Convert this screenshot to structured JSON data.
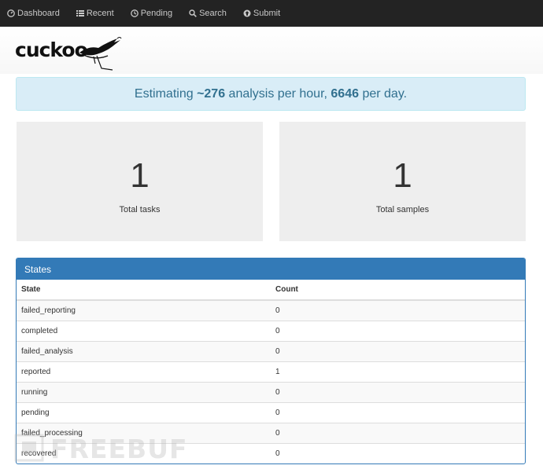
{
  "nav": {
    "items": [
      {
        "label": "Dashboard",
        "icon": "dashboard-icon"
      },
      {
        "label": "Recent",
        "icon": "list-icon"
      },
      {
        "label": "Pending",
        "icon": "clock-icon"
      },
      {
        "label": "Search",
        "icon": "search-icon"
      },
      {
        "label": "Submit",
        "icon": "upload-icon"
      }
    ]
  },
  "logo": {
    "text": "cuckoo"
  },
  "estimate": {
    "prefix": "Estimating ",
    "per_hour": "~276",
    "middle": " analysis per hour, ",
    "per_day": "6646",
    "suffix": " per day."
  },
  "stats": {
    "total_tasks": {
      "value": "1",
      "label": "Total tasks"
    },
    "total_samples": {
      "value": "1",
      "label": "Total samples"
    }
  },
  "states_panel": {
    "title": "States",
    "columns": [
      "State",
      "Count"
    ],
    "rows": [
      {
        "state": "failed_reporting",
        "count": "0"
      },
      {
        "state": "completed",
        "count": "0"
      },
      {
        "state": "failed_analysis",
        "count": "0"
      },
      {
        "state": "reported",
        "count": "1"
      },
      {
        "state": "running",
        "count": "0"
      },
      {
        "state": "pending",
        "count": "0"
      },
      {
        "state": "failed_processing",
        "count": "0"
      },
      {
        "state": "recovered",
        "count": "0"
      }
    ]
  },
  "watermark": {
    "text": "FREEBUF"
  }
}
